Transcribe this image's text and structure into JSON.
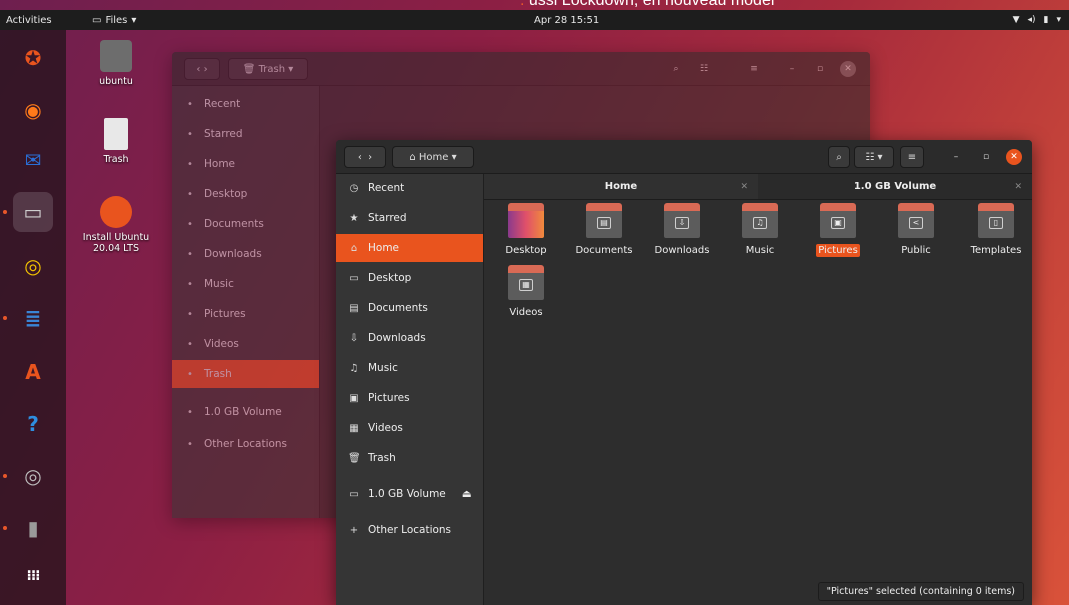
{
  "overlay": {
    "caption": "ussi Lockdown, en nouveau modèl"
  },
  "topbar": {
    "activities": "Activities",
    "app_menu": "Files",
    "clock": "Apr 28 15:51",
    "tray_icons": [
      "wifi-icon",
      "volume-icon",
      "battery-icon",
      "menu-arrow-icon"
    ]
  },
  "dock": {
    "items": [
      {
        "name": "ubuntu-installer-icon",
        "glyph": "✪",
        "color": "#e9541e"
      },
      {
        "name": "firefox-icon",
        "glyph": "◉",
        "color": "#ff7a1a"
      },
      {
        "name": "thunderbird-icon",
        "glyph": "✉",
        "color": "#2a6fd6"
      },
      {
        "name": "files-icon",
        "glyph": "▭",
        "color": "#cfcfcf"
      },
      {
        "name": "rhythmbox-icon",
        "glyph": "◎",
        "color": "#f3c400"
      },
      {
        "name": "libreoffice-writer-icon",
        "glyph": "≣",
        "color": "#3a84d6"
      },
      {
        "name": "software-center-icon",
        "glyph": "A",
        "color": "#e9541e"
      },
      {
        "name": "help-icon",
        "glyph": "?",
        "color": "#2e8ee0"
      },
      {
        "name": "settings-disc-icon",
        "glyph": "◎",
        "color": "#bdbdbd"
      },
      {
        "name": "usb-drive-icon",
        "glyph": "▮",
        "color": "#9a9a9a"
      },
      {
        "name": "show-applications-icon",
        "glyph": "⁝⁝⁝",
        "color": "#ffffff"
      }
    ]
  },
  "desktop": {
    "icons": [
      {
        "label": "ubuntu"
      },
      {
        "label": "Trash"
      },
      {
        "label": "Install Ubuntu 20.04 LTS"
      }
    ]
  },
  "back_window": {
    "location": "Trash",
    "sidebar": [
      "Recent",
      "Starred",
      "Home",
      "Desktop",
      "Documents",
      "Downloads",
      "Music",
      "Pictures",
      "Videos",
      "Trash",
      "1.0 GB Volume",
      "Other Locations"
    ],
    "selected": "Trash"
  },
  "front_window": {
    "location": "Home",
    "tabs": [
      {
        "label": "Home",
        "active": true
      },
      {
        "label": "1.0 GB Volume",
        "active": false
      }
    ],
    "sidebar": [
      {
        "label": "Recent",
        "icon": "clock-icon",
        "glyph": "◷"
      },
      {
        "label": "Starred",
        "icon": "star-icon",
        "glyph": "★"
      },
      {
        "label": "Home",
        "icon": "home-icon",
        "glyph": "⌂"
      },
      {
        "label": "Desktop",
        "icon": "desktop-icon",
        "glyph": "▭"
      },
      {
        "label": "Documents",
        "icon": "documents-icon",
        "glyph": "▤"
      },
      {
        "label": "Downloads",
        "icon": "downloads-icon",
        "glyph": "⇩"
      },
      {
        "label": "Music",
        "icon": "music-icon",
        "glyph": "♫"
      },
      {
        "label": "Pictures",
        "icon": "pictures-icon",
        "glyph": "▣"
      },
      {
        "label": "Videos",
        "icon": "videos-icon",
        "glyph": "▦"
      },
      {
        "label": "Trash",
        "icon": "trash-icon",
        "glyph": "🗑"
      },
      {
        "label": "1.0 GB Volume",
        "icon": "drive-icon",
        "glyph": "▭"
      },
      {
        "label": "Other Locations",
        "icon": "plus-icon",
        "glyph": "+"
      }
    ],
    "selected_sidebar": "Home",
    "folders": [
      {
        "label": "Desktop",
        "emblem": ""
      },
      {
        "label": "Documents",
        "emblem": "▤"
      },
      {
        "label": "Downloads",
        "emblem": "⇩"
      },
      {
        "label": "Music",
        "emblem": "♫"
      },
      {
        "label": "Pictures",
        "emblem": "▣"
      },
      {
        "label": "Public",
        "emblem": "<"
      },
      {
        "label": "Templates",
        "emblem": "▯"
      },
      {
        "label": "Videos",
        "emblem": "▦"
      }
    ],
    "selected_folder": "Pictures",
    "status": "\"Pictures\" selected (containing 0 items)"
  },
  "colors": {
    "accent": "#e9541e",
    "topbar": "#1d1d1d",
    "window_bg": "#2d2d2d",
    "sidebar_bg": "#353535"
  }
}
